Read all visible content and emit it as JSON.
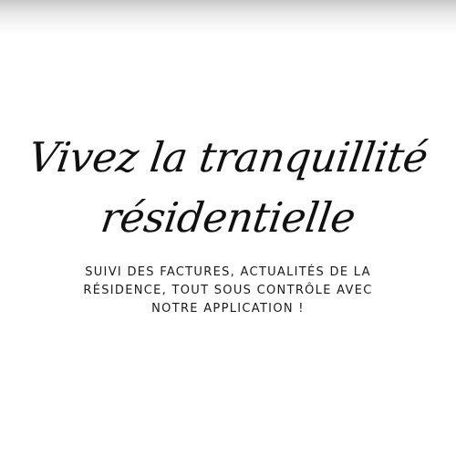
{
  "headline": {
    "line1": "Vivez la tranquillité",
    "line2": "résidentielle"
  },
  "subtitle": {
    "line1": "SUIVI DES FACTURES, ACTUALITÉS DE LA",
    "line2": "RÉSIDENCE, TOUT SOUS CONTRÔLE AVEC",
    "line3": "NOTRE APPLICATION !"
  },
  "colors": {
    "background": "#ffffff",
    "text": "#111111"
  }
}
